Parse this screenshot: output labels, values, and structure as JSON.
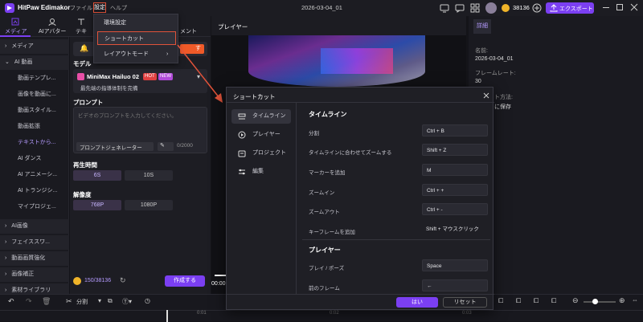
{
  "app": {
    "title": "HitPaw Edimakor",
    "doc_title": "2026-03-04_01",
    "credits": "38136",
    "export_label": "エクスポート"
  },
  "menubar": {
    "file": "ファイル",
    "settings": "設定",
    "help": "ヘルプ"
  },
  "settings_menu": {
    "items": [
      {
        "label": "環境設定"
      },
      {
        "label": "ショートカット"
      },
      {
        "label": "レイアウトモード"
      }
    ]
  },
  "top_tabs": {
    "media": "メディア",
    "avatar": "AIアバター",
    "text": "テキ",
    "element": "メント"
  },
  "leftnav": {
    "items": [
      {
        "label": "メディア"
      },
      {
        "label": "AI 動画"
      },
      {
        "label": "動画テンプレ..."
      },
      {
        "label": "画像を動画に..."
      },
      {
        "label": "動画スタイル..."
      },
      {
        "label": "動画拡張"
      },
      {
        "label": "テキストから..."
      },
      {
        "label": "AI ダンス"
      },
      {
        "label": "AI アニメーシ..."
      },
      {
        "label": "AI トランジシ..."
      },
      {
        "label": "マイプロジェ..."
      },
      {
        "label": "AI画像"
      },
      {
        "label": "フェイススワ..."
      },
      {
        "label": "動画画質強化"
      },
      {
        "label": "画像補正"
      },
      {
        "label": "素材ライブラリ"
      }
    ]
  },
  "ai_panel": {
    "model_label": "モデル",
    "model_name": "MiniMax Hailuo 02",
    "hot_badge": "HOT",
    "new_badge": "NEW",
    "model_desc": "最先端の指導体制を完備",
    "prompt_label": "プロンプト",
    "prompt_placeholder": "ビデオのプロンプトを入力してください。",
    "prompt_gen": "プロンプトジェネレーター",
    "prompt_count": "0/2000",
    "duration_label": "再生時間",
    "durations": [
      "6S",
      "10S"
    ],
    "resolution_label": "解像度",
    "resolutions": [
      "768P",
      "1080P"
    ],
    "credits": "150/38136",
    "create_label": "作成する",
    "hidden_btn": "す"
  },
  "player": {
    "title": "プレイヤー",
    "time": "00:00"
  },
  "details": {
    "tab": "詳細",
    "name_label": "名前:",
    "name_value": "2026-03-04_01",
    "framerate_label": "フレームレート:",
    "framerate_value": "30",
    "method_label": "ト方法:",
    "method_value": "に保存"
  },
  "shortcut_dialog": {
    "title": "ショートカット",
    "nav": [
      {
        "label": "タイムライン"
      },
      {
        "label": "プレイヤー"
      },
      {
        "label": "プロジェクト"
      },
      {
        "label": "編集"
      }
    ],
    "sections": [
      {
        "title": "タイムライン",
        "rows": [
          {
            "label": "分割",
            "key": "Ctrl + B"
          },
          {
            "label": "タイムラインに合わせてズームする",
            "key": "Shift + Z"
          },
          {
            "label": "マーカーを追加",
            "key": "M"
          },
          {
            "label": "ズームイン",
            "key": "Ctrl + +"
          },
          {
            "label": "ズームアウト",
            "key": "Ctrl + -"
          },
          {
            "label": "キーフレームを追加",
            "key": "Shift + マウスクリック"
          }
        ]
      },
      {
        "title": "プレイヤー",
        "rows": [
          {
            "label": "プレイ / ポーズ",
            "key": "Space"
          },
          {
            "label": "前のフレーム",
            "key": "←"
          }
        ]
      }
    ],
    "ok_label": "はい",
    "reset_label": "リセット"
  },
  "timeline": {
    "split_label": "分割",
    "ticks": [
      "0:01",
      "0:02",
      "0:03"
    ]
  },
  "colors": {
    "accent": "#7b3ff2",
    "highlight_border": "#e0533a",
    "arrow": "#e0533a"
  }
}
